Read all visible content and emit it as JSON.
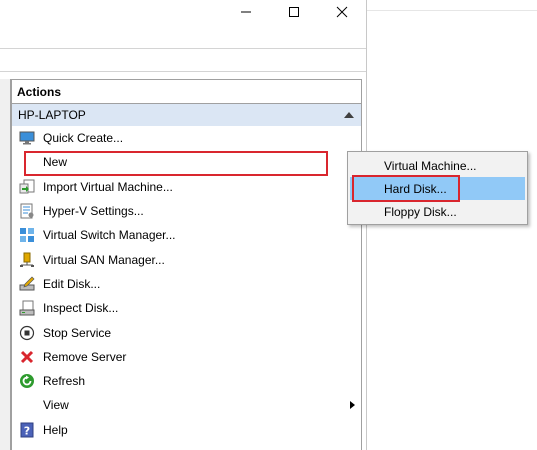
{
  "window": {
    "controls": [
      "minimize-icon",
      "maximize-icon",
      "close-icon"
    ]
  },
  "actions": {
    "header": "Actions",
    "group": "HP-LAPTOP",
    "items": [
      {
        "label": "Quick Create...",
        "icon": "monitor-icon"
      },
      {
        "label": "New",
        "icon": "",
        "submenu": true
      },
      {
        "label": "Import Virtual Machine...",
        "icon": "import-icon"
      },
      {
        "label": "Hyper-V Settings...",
        "icon": "settings-doc-icon"
      },
      {
        "label": "Virtual Switch Manager...",
        "icon": "network-switch-icon"
      },
      {
        "label": "Virtual SAN Manager...",
        "icon": "san-icon"
      },
      {
        "label": "Edit Disk...",
        "icon": "edit-disk-icon"
      },
      {
        "label": "Inspect Disk...",
        "icon": "inspect-disk-icon"
      },
      {
        "label": "Stop Service",
        "icon": "stop-icon"
      },
      {
        "label": "Remove Server",
        "icon": "remove-icon"
      },
      {
        "label": "Refresh",
        "icon": "refresh-icon"
      },
      {
        "label": "View",
        "icon": "",
        "submenu": true
      },
      {
        "label": "Help",
        "icon": "help-icon"
      }
    ]
  },
  "submenu": {
    "items": [
      {
        "label": "Virtual Machine..."
      },
      {
        "label": "Hard Disk...",
        "selected": true
      },
      {
        "label": "Floppy Disk..."
      }
    ]
  },
  "colors": {
    "highlight_box": "#d9262e",
    "group_header_bg": "#dbe6f4",
    "submenu_selected": "#91c9f7"
  }
}
